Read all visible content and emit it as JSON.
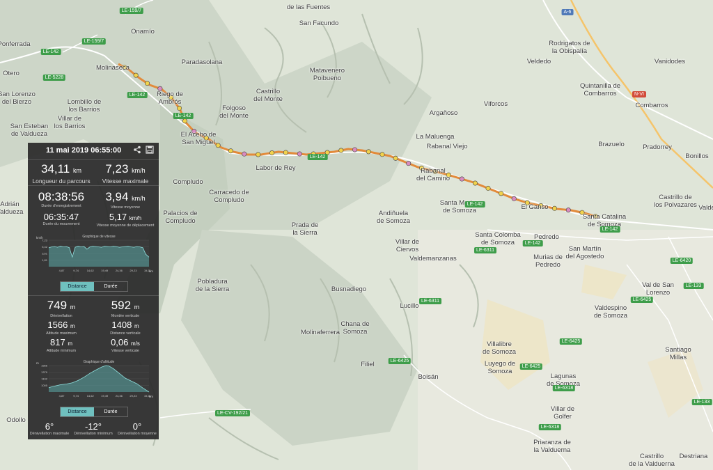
{
  "map": {
    "places": [
      {
        "id": "ponferrada",
        "label": "Ponferrada"
      },
      {
        "id": "onamio",
        "label": "Onamío"
      },
      {
        "id": "lasfuentes",
        "label": "de las Fuentes"
      },
      {
        "id": "sanfacundo",
        "label": "San Facundo"
      },
      {
        "id": "rodrigatos",
        "label": "Rodrigatos de\nla Obispalía"
      },
      {
        "id": "vanidodes",
        "label": "Vanidodes"
      },
      {
        "id": "otero",
        "label": "Otero"
      },
      {
        "id": "molinaseca",
        "label": "Molinaseca"
      },
      {
        "id": "paradasolana",
        "label": "Paradasolana"
      },
      {
        "id": "matavenero",
        "label": "Matavenero\nPoibueno"
      },
      {
        "id": "veldedo",
        "label": "Veldedo"
      },
      {
        "id": "quintanilla",
        "label": "Quintanilla de\nCombarros"
      },
      {
        "id": "sanlorenzo",
        "label": "San Lorenzo\ndel Bierzo"
      },
      {
        "id": "lombillo",
        "label": "Lombillo de\nlos Barrios"
      },
      {
        "id": "riego",
        "label": "Riego de\nAmbrós"
      },
      {
        "id": "castrillomonte",
        "label": "Castrillo\ndel Monte"
      },
      {
        "id": "combarros",
        "label": "Combarros"
      },
      {
        "id": "villarbarrios",
        "label": "Villar de\nlos Barrios"
      },
      {
        "id": "folgoso",
        "label": "Folgoso\ndel Monte"
      },
      {
        "id": "viforcos",
        "label": "Viforcos"
      },
      {
        "id": "arganoso",
        "label": "Argañoso"
      },
      {
        "id": "sanesteban",
        "label": "San Esteban\nde Valdueza"
      },
      {
        "id": "acebo",
        "label": "El Acebo de\nSan Miguel"
      },
      {
        "id": "lamaluenga",
        "label": "La Maluenga"
      },
      {
        "id": "brazuelo",
        "label": "Brazuelo"
      },
      {
        "id": "pradorrey",
        "label": "Pradorrey"
      },
      {
        "id": "bonillos",
        "label": "Bonillos"
      },
      {
        "id": "rabanal",
        "label": "Rabanal Viejo"
      },
      {
        "id": "labor",
        "label": "Labor de Rey"
      },
      {
        "id": "rabanalcamino",
        "label": "Rabanal\ndel Camino"
      },
      {
        "id": "compludo",
        "label": "Compludo"
      },
      {
        "id": "carracedo",
        "label": "Carracedo de\nCompludo"
      },
      {
        "id": "castrillopolv",
        "label": "Castrillo de\nlos Polvazares"
      },
      {
        "id": "adrian",
        "label": "Adrián\nValdueza"
      },
      {
        "id": "santamarina",
        "label": "Santa Marina\nde Somoza"
      },
      {
        "id": "elganso",
        "label": "El Ganso"
      },
      {
        "id": "santacatalina",
        "label": "Santa Catalina\nde Somoza"
      },
      {
        "id": "palacios",
        "label": "Palacios de\nCompludo"
      },
      {
        "id": "andinuela",
        "label": "Andiñuela\nde Somoza"
      },
      {
        "id": "prada",
        "label": "Prada de\nla Sierra"
      },
      {
        "id": "santacolomba",
        "label": "Santa Colomba\nde Somoza"
      },
      {
        "id": "pedredo",
        "label": "Pedredo"
      },
      {
        "id": "villarciervos",
        "label": "Villar de\nCiervos"
      },
      {
        "id": "sanmartin",
        "label": "San Martín\ndel Agostedo"
      },
      {
        "id": "valdemanzanas",
        "label": "Valdemanzanas"
      },
      {
        "id": "murias",
        "label": "Murias de\nPedredo"
      },
      {
        "id": "pobladura",
        "label": "Pobladura\nde la Sierra"
      },
      {
        "id": "busnadiego",
        "label": "Busnadiego"
      },
      {
        "id": "valsanlorenzo",
        "label": "Val de San\nLorenzo"
      },
      {
        "id": "lucillo",
        "label": "Lucillo"
      },
      {
        "id": "valdespino",
        "label": "Valdespino\nde Somoza"
      },
      {
        "id": "chana",
        "label": "Chana de\nSomoza"
      },
      {
        "id": "molinaferrera",
        "label": "Molinaferrera"
      },
      {
        "id": "villalibre",
        "label": "Villalibre\nde Somoza"
      },
      {
        "id": "santiago",
        "label": "Santiago\nMillas"
      },
      {
        "id": "filiel",
        "label": "Filiel"
      },
      {
        "id": "luyego",
        "label": "Luyego de\nSomoza"
      },
      {
        "id": "lagunas",
        "label": "Lagunas\nde Somoza"
      },
      {
        "id": "boisan",
        "label": "Boisán"
      },
      {
        "id": "villargolfer",
        "label": "Villar de\nGolfer"
      },
      {
        "id": "odollo",
        "label": "Odollo"
      },
      {
        "id": "priaranza",
        "label": "Priaranza de\nla Valduerna"
      },
      {
        "id": "castrillovald",
        "label": "Castrillo\nde la Valduerna"
      },
      {
        "id": "destriana",
        "label": "Destriana"
      },
      {
        "id": "valde",
        "label": "Valde"
      }
    ],
    "roads": [
      {
        "id": "le159a",
        "label": "LE-159/7"
      },
      {
        "id": "le159b",
        "label": "LE-159/7"
      },
      {
        "id": "le142a",
        "label": "LE-142"
      },
      {
        "id": "le5228",
        "label": "LE-5228"
      },
      {
        "id": "le142b",
        "label": "LE-142"
      },
      {
        "id": "le142c",
        "label": "LE-142"
      },
      {
        "id": "a6",
        "label": "A-6"
      },
      {
        "id": "nvi",
        "label": "N-VI"
      },
      {
        "id": "le142d",
        "label": "LE-142"
      },
      {
        "id": "le142e",
        "label": "LE-142"
      },
      {
        "id": "le142f",
        "label": "LE-142"
      },
      {
        "id": "le142g",
        "label": "LE-142"
      },
      {
        "id": "le6311a",
        "label": "LE-6311"
      },
      {
        "id": "le6420",
        "label": "LE-6420"
      },
      {
        "id": "le133a",
        "label": "LE-133"
      },
      {
        "id": "le6425a",
        "label": "LE-6425"
      },
      {
        "id": "le6311b",
        "label": "LE-6311"
      },
      {
        "id": "le6425b",
        "label": "LE-6425"
      },
      {
        "id": "le6425c",
        "label": "LE-6425"
      },
      {
        "id": "le6425d",
        "label": "LE-6425"
      },
      {
        "id": "le6318a",
        "label": "LE-6318"
      },
      {
        "id": "le133b",
        "label": "LE-133"
      },
      {
        "id": "lecv",
        "label": "LE-CV-192/21"
      },
      {
        "id": "le6318b",
        "label": "LE-6318"
      }
    ]
  },
  "panel": {
    "date": "11 mai 2019 06:55:00",
    "distance": {
      "value": "34,11",
      "unit": "km",
      "label": "Longueur du parcours"
    },
    "maxspeed": {
      "value": "7,23",
      "unit": "km/h",
      "label": "Vitesse maximale"
    },
    "rectime": {
      "value": "08:38:56",
      "label": "Durée d'enregistrement"
    },
    "avgspeed": {
      "value": "3,94",
      "unit": "km/h",
      "label": "Vitesse moyenne"
    },
    "movetime": {
      "value": "06:35:47",
      "label": "Durée du mouvement"
    },
    "avgmovespeed": {
      "value": "5,17",
      "unit": "km/h",
      "label": "Vitesse moyenne de déplacement"
    },
    "speedchart": {
      "title": "Graphique de vitesse",
      "unit": "km/h",
      "xunit": "km"
    },
    "toggle1": {
      "a": "Distance",
      "b": "Durée"
    },
    "denivel": {
      "value": "749",
      "unit": "m",
      "label": "Dénivellation"
    },
    "climb": {
      "value": "592",
      "unit": "m",
      "label": "Montée verticale"
    },
    "altmax": {
      "value": "1566",
      "unit": "m",
      "label": "Altitude maximum"
    },
    "vdist": {
      "value": "1408",
      "unit": "m",
      "label": "Distance verticale"
    },
    "altmin": {
      "value": "817",
      "unit": "m",
      "label": "Altitude minimum"
    },
    "vspeed": {
      "value": "0,06",
      "unit": "m/s",
      "label": "Vitesse verticale"
    },
    "altchart": {
      "title": "Graphique d'altitude",
      "unit": "m",
      "xunit": "km"
    },
    "toggle2": {
      "a": "Distance",
      "b": "Durée"
    },
    "grademax": {
      "value": "6°",
      "label": "Dénivellation maximale"
    },
    "grademin": {
      "value": "-12°",
      "label": "Dénivellation minimum"
    },
    "gradeavg": {
      "value": "0°",
      "label": "Dénivellation moyenne"
    }
  },
  "chart_data": [
    {
      "type": "area",
      "title": "Graphique de vitesse",
      "ylabel": "km/h",
      "xlabel": "km",
      "x_ticks": [
        "4,87",
        "9,74",
        "14,62",
        "19,49",
        "24,36",
        "29,23",
        "34,11"
      ],
      "y_ticks": [
        "1,81",
        "3,61",
        "5,42",
        "7,23"
      ],
      "ylim": [
        0,
        7.23
      ],
      "xlim": [
        0,
        34.11
      ],
      "series": [
        {
          "x": [
            0,
            1,
            2,
            3,
            4,
            5,
            6,
            7,
            8,
            9,
            10,
            11,
            12,
            13,
            14,
            15,
            16,
            17,
            18,
            19,
            20,
            21,
            22,
            23,
            24,
            25,
            26,
            27,
            28,
            29,
            30,
            31,
            32,
            33,
            34.11
          ],
          "y": [
            5.2,
            5.4,
            5.5,
            5.3,
            5.6,
            5.4,
            5.5,
            5.2,
            2.6,
            5.3,
            5.6,
            5.4,
            5.5,
            4.8,
            5.4,
            5.6,
            5.5,
            5.4,
            5.3,
            5.6,
            5.5,
            5.4,
            5.6,
            5.5,
            5.3,
            5.4,
            5.5,
            5.6,
            5.4,
            5.3,
            5.5,
            5.4,
            5.2,
            3.4,
            2.6
          ]
        }
      ]
    },
    {
      "type": "area",
      "title": "Graphique d'altitude",
      "ylabel": "m",
      "xlabel": "km",
      "x_ticks": [
        "4,87",
        "9,74",
        "14,62",
        "19,49",
        "24,36",
        "29,23",
        "34,11"
      ],
      "y_ticks": [
        "1005",
        "1192",
        "1379",
        "1566"
      ],
      "ylim": [
        1005,
        1566
      ],
      "xlim": [
        0,
        34.11
      ],
      "series": [
        {
          "x": [
            0,
            2,
            4,
            6,
            8,
            10,
            12,
            14,
            16,
            18,
            19.5,
            20.5,
            22,
            24,
            26,
            28,
            30,
            32,
            34.11
          ],
          "y": [
            1100,
            1130,
            1160,
            1175,
            1200,
            1250,
            1320,
            1400,
            1470,
            1535,
            1566,
            1555,
            1500,
            1400,
            1300,
            1240,
            1180,
            1090,
            1005
          ]
        }
      ]
    }
  ]
}
